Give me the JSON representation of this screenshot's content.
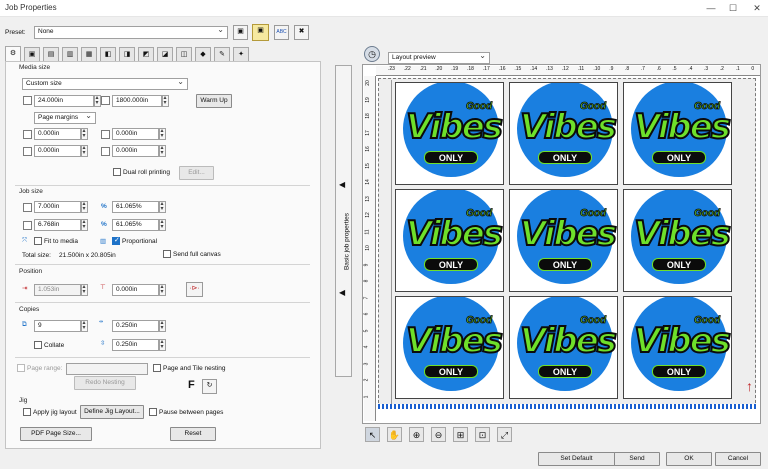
{
  "window": {
    "title": "Job Properties",
    "minimize": "—",
    "maximize": "☐",
    "close": "✕"
  },
  "preset": {
    "label": "Preset:",
    "value": "None",
    "abc_label": "ABC"
  },
  "tabs": [
    "⚙",
    "▣",
    "▤",
    "▥",
    "▦",
    "◧",
    "◨",
    "◩",
    "◪",
    "◫",
    "◆",
    "✎",
    "✦"
  ],
  "media": {
    "section": "Media size",
    "size_value": "Custom size",
    "width": "24.000in",
    "height": "1800.000in",
    "warm_up": "Warm Up",
    "margins_value": "Page margins",
    "margin_left": "0.000in",
    "margin_right": "0.000in",
    "margin_top": "0.000in",
    "margin_bottom": "0.000in",
    "dual_roll": "Dual roll printing",
    "edit": "Edit..."
  },
  "job": {
    "section": "Job size",
    "width": "7.000in",
    "height": "6.768in",
    "scale_w": "61.065%",
    "scale_h": "61.065%",
    "percent": "%",
    "fit_to_media": "Fit to media",
    "proportional": "Proportional",
    "total_label": "Total size:",
    "total_value": "21.500in x 20.805in",
    "send_full_canvas": "Send full canvas"
  },
  "position": {
    "section": "Position",
    "x": "1.053in",
    "y": "0.000in"
  },
  "copies": {
    "section": "Copies",
    "count": "9",
    "gap_h": "0.250in",
    "gap_v": "0.250in",
    "collate": "Collate"
  },
  "nesting": {
    "page_range": "Page range:",
    "page_and_tile": "Page and Tile nesting",
    "redo": "Redo Nesting",
    "f_label": "F"
  },
  "jig": {
    "section": "Jig",
    "apply": "Apply jig layout",
    "define": "Define Jig Layout...",
    "pause": "Pause between pages"
  },
  "bottom_left": {
    "pdf_page_size": "PDF Page Size...",
    "reset": "Reset"
  },
  "side_panel": {
    "label": "Basic job properties"
  },
  "preview": {
    "mode": "Layout preview",
    "ruler_top": [
      ".23",
      ".22",
      ".21",
      ".20",
      ".19",
      ".18",
      ".17",
      ".16",
      ".15",
      ".14",
      ".13",
      ".12",
      ".11",
      ".10",
      ".9",
      ".8",
      ".7",
      ".6",
      ".5",
      ".4",
      ".3",
      ".2",
      ".1",
      "0"
    ],
    "ruler_left": [
      "20",
      "19",
      "18",
      "17",
      "16",
      "15",
      "14",
      "13",
      "12",
      "11",
      "10",
      "9",
      "8",
      "7",
      "6",
      "5",
      "4",
      "3",
      "2",
      "1"
    ],
    "tiles": [
      {
        "big": "Vibes",
        "small": "Good",
        "band": "ONLY"
      },
      {
        "big": "Vibes",
        "small": "Good",
        "band": "ONLY"
      },
      {
        "big": "Vibes",
        "small": "Good",
        "band": "ONLY"
      },
      {
        "big": "Vibes",
        "small": "Good",
        "band": "ONLY"
      },
      {
        "big": "Vibes",
        "small": "Good",
        "band": "ONLY"
      },
      {
        "big": "Vibes",
        "small": "Good",
        "band": "ONLY"
      },
      {
        "big": "Vibes",
        "small": "Good",
        "band": "ONLY"
      },
      {
        "big": "Vibes",
        "small": "Good",
        "band": "ONLY"
      },
      {
        "big": "Vibes",
        "small": "Good",
        "band": "ONLY"
      }
    ],
    "tools": [
      "↖",
      "✋",
      "⊕",
      "⊖",
      "⊞",
      "⊡",
      "⤢"
    ]
  },
  "footer": {
    "set_default": "Set Default",
    "send": "Send",
    "ok": "OK",
    "cancel": "Cancel"
  },
  "colors": {
    "accent": "#1e72c8",
    "badge_blue": "#1a7fe0",
    "badge_green": "#6ee02a",
    "ink": "#0b0b0b"
  }
}
